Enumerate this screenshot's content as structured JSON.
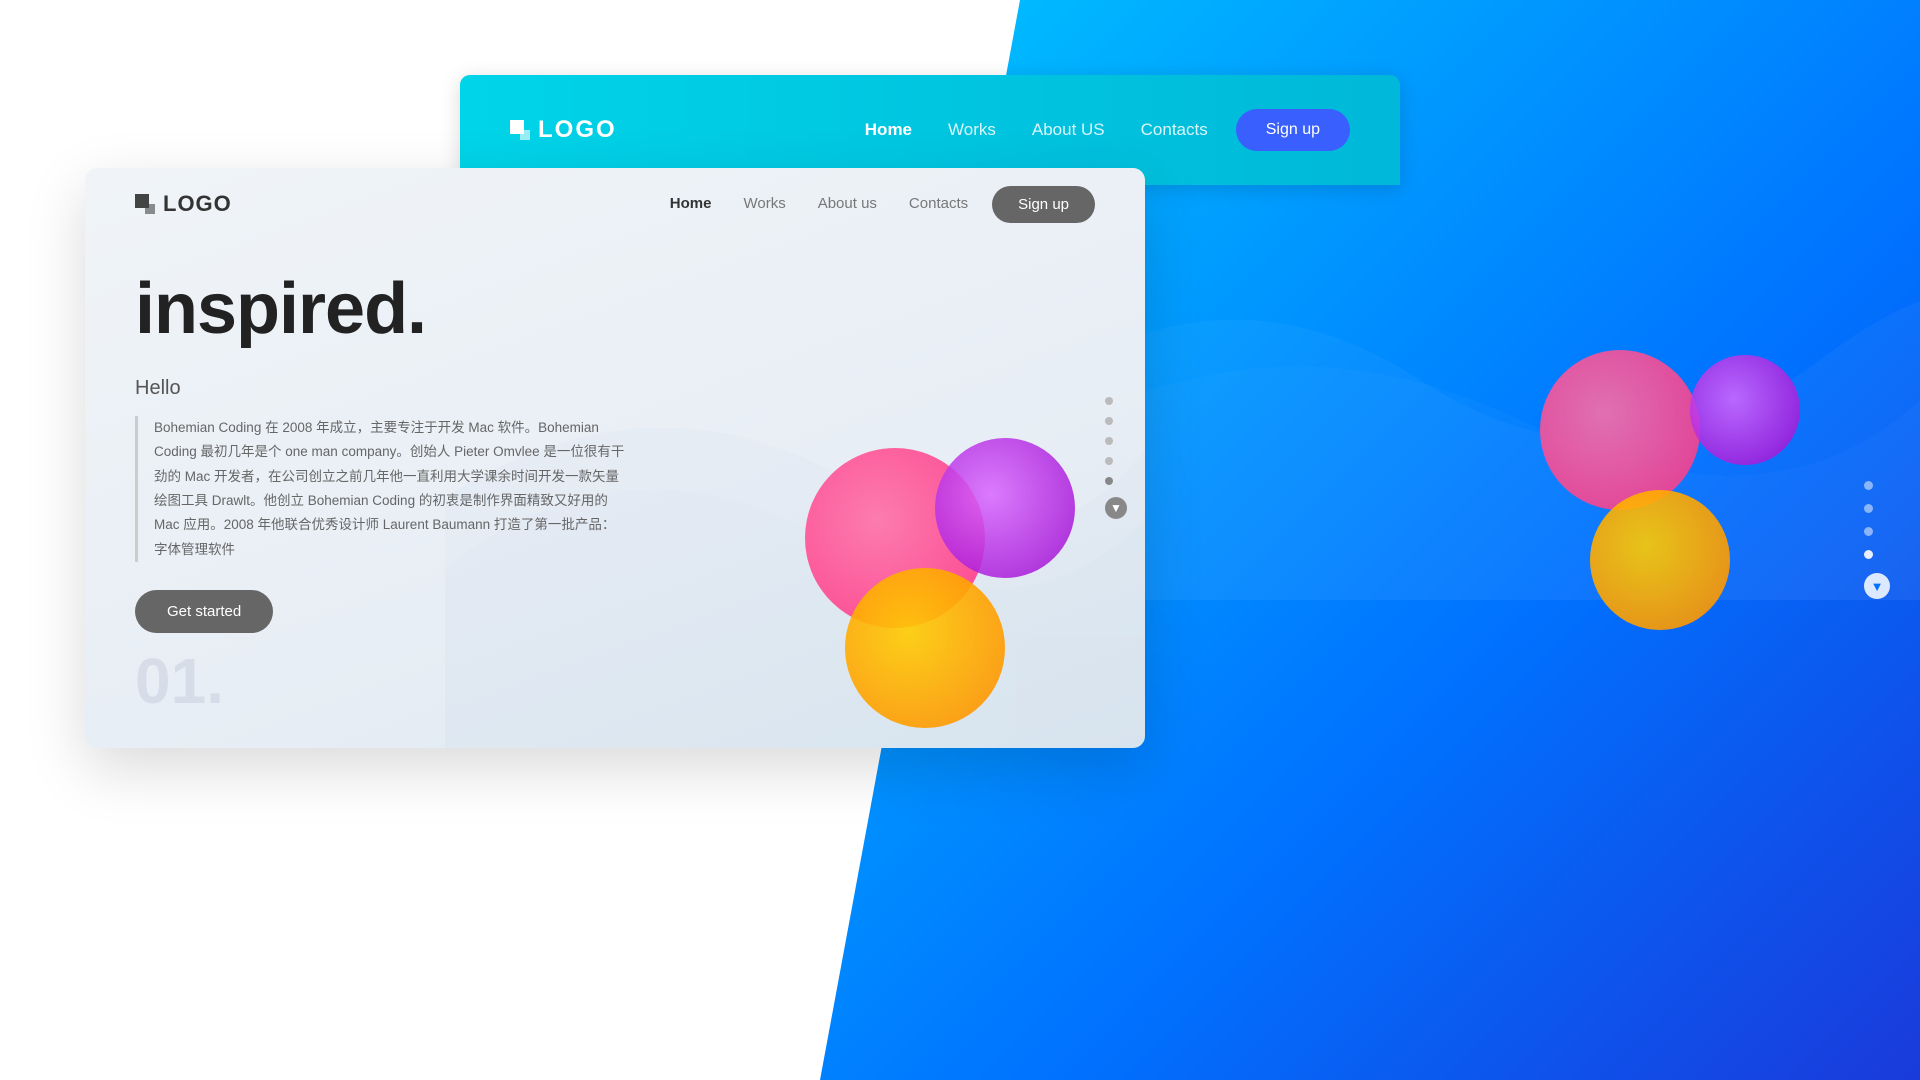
{
  "background": {
    "color_start": "#00c6ff",
    "color_end": "#0072ff"
  },
  "back_card": {
    "logo_text": "LOGO",
    "nav": {
      "home": "Home",
      "works": "Works",
      "about_us": "About US",
      "contacts": "Contacts"
    },
    "signup_label": "Sign up"
  },
  "front_card": {
    "logo_text": "LOGO",
    "nav": {
      "home": "Home",
      "works": "Works",
      "about_us": "About us",
      "contacts": "Contacts"
    },
    "signup_label": "Sign up",
    "headline": "inspired.",
    "hello": "Hello",
    "body_text": "Bohemian Coding 在 2008 年成立，主要专注于开发 Mac 软件。Bohemian Coding 最初几年是个 one man company。创始人 Pieter Omvlee 是一位很有干劲的 Mac 开发者，在公司创立之前几年他一直利用大学课余时间开发一款矢量绘图工具 Drawlt。他创立 Bohemian Coding 的初衷是制作界面精致又好用的 Mac 应用。2008 年他联合优秀设计师 Laurent Baumann 打造了第一批产品：字体管理软件",
    "get_started_label": "Get started",
    "page_number": "01."
  },
  "dots": {
    "count": 5,
    "active_index": 4,
    "arrow_symbol": "▼"
  },
  "right_dots": {
    "count": 4,
    "active_index": 3,
    "arrow_symbol": "▼"
  }
}
